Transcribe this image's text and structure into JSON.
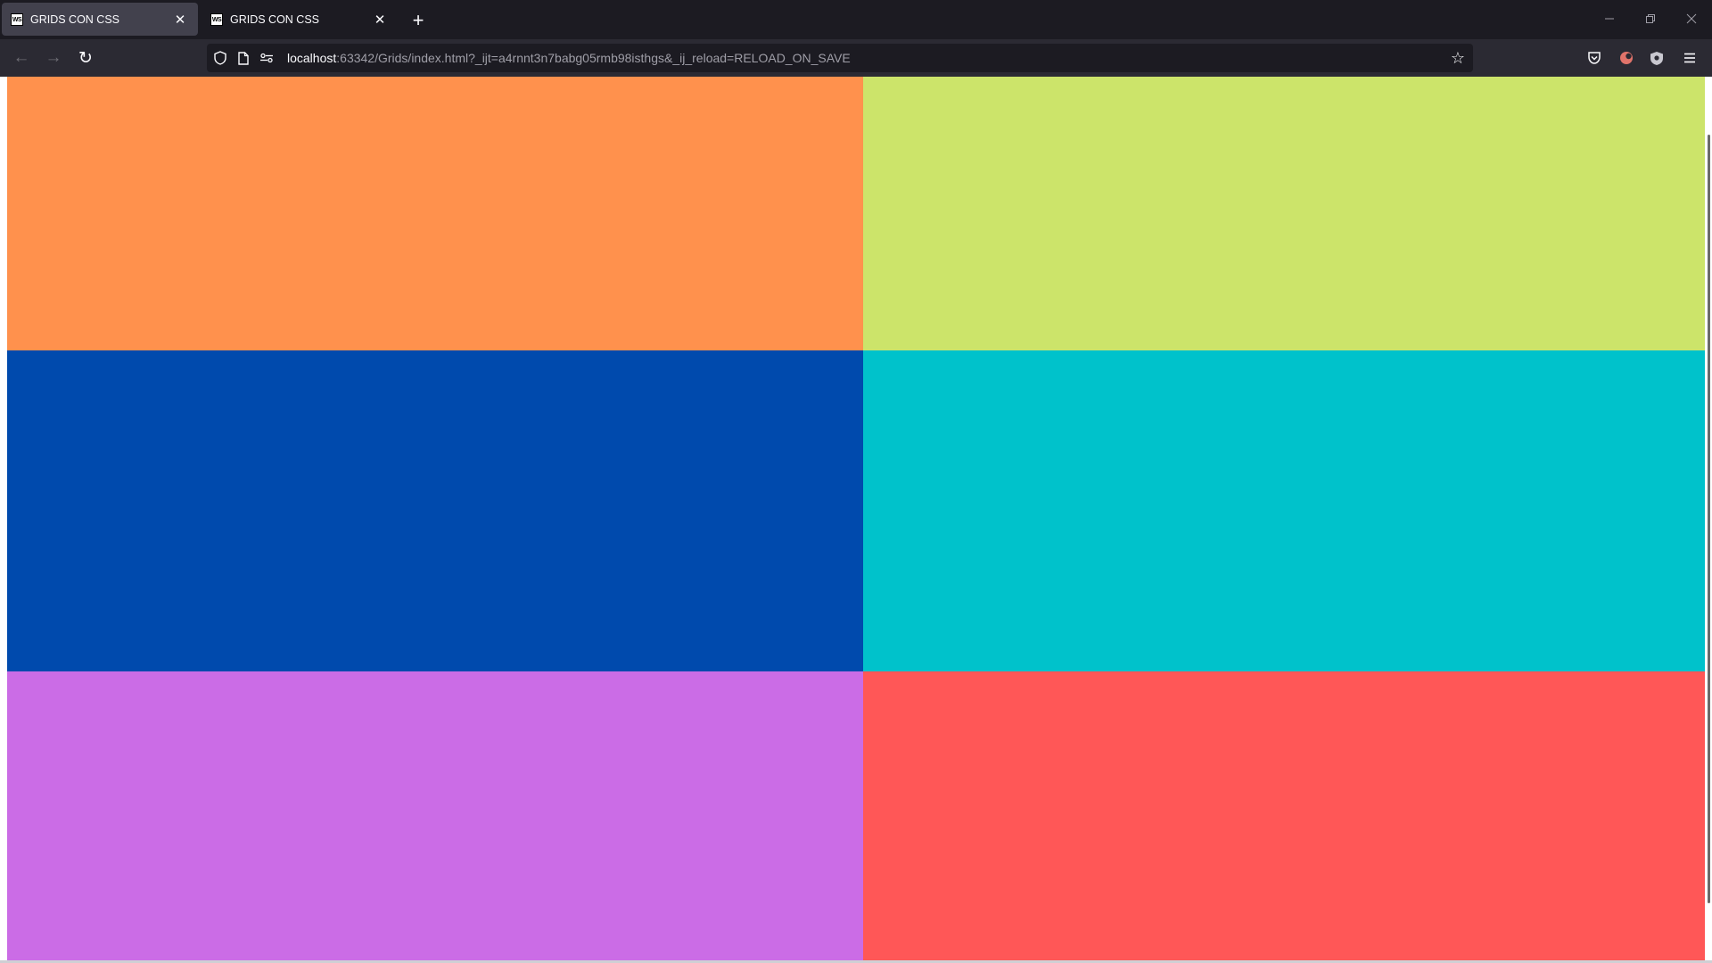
{
  "tabs": [
    {
      "favicon": "WS",
      "title": "GRIDS CON CSS",
      "active": true
    },
    {
      "favicon": "WS",
      "title": "GRIDS CON CSS",
      "active": false
    }
  ],
  "tabbar": {
    "close_glyph": "✕",
    "new_tab_glyph": "+",
    "minimize_glyph": "—",
    "restore_glyph": "❐",
    "window_close_glyph": "✕"
  },
  "nav": {
    "back_glyph": "←",
    "forward_glyph": "→",
    "reload_glyph": "↻",
    "url_host": "localhost",
    "url_rest": ":63342/Grids/index.html?_ijt=a4rnnt3n7babg05rmb98isthgs&_ij_reload=RELOAD_ON_SAVE",
    "star_glyph": "☆",
    "menu_glyph": "≡"
  },
  "grid": {
    "cells": [
      {
        "name": "orange",
        "color": "#ff914d"
      },
      {
        "name": "lime",
        "color": "#cce46a"
      },
      {
        "name": "blue",
        "color": "#004aad"
      },
      {
        "name": "cyan",
        "color": "#00c2cb"
      },
      {
        "name": "purple",
        "color": "#cb6ce6"
      },
      {
        "name": "red",
        "color": "#ff5757"
      }
    ]
  },
  "icons": [
    "shield-icon",
    "page-icon",
    "permissions-icon",
    "bookmark-star-icon",
    "pocket-icon",
    "extension-icon",
    "shield-extension-icon",
    "app-menu-icon"
  ]
}
